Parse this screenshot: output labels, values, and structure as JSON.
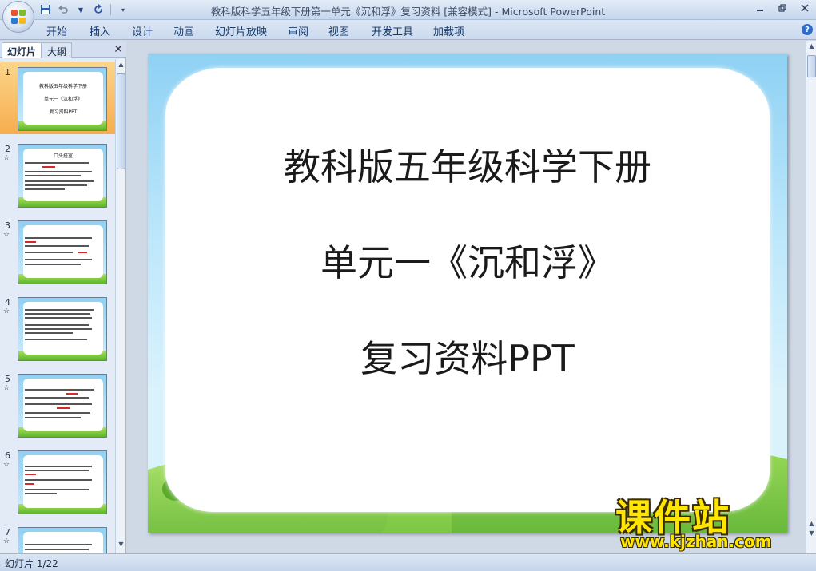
{
  "window": {
    "title": "教科版科学五年级下册第一单元《沉和浮》复习资料 [兼容模式] - Microsoft PowerPoint"
  },
  "ribbon": {
    "tabs": [
      "开始",
      "插入",
      "设计",
      "动画",
      "幻灯片放映",
      "审阅",
      "视图",
      "开发工具",
      "加载项"
    ]
  },
  "left_pane": {
    "tabs": [
      "幻灯片",
      "大纲"
    ],
    "active_tab": "幻灯片",
    "thumbnails": [
      {
        "number": "1",
        "lines": [
          "教科版五年级科学下册",
          "单元一《沉和浮》",
          "复习资料PPT"
        ],
        "selected": true,
        "animated": false
      },
      {
        "number": "2",
        "lines": [
          "口头搭室"
        ],
        "selected": false,
        "animated": true
      },
      {
        "number": "3",
        "lines": [],
        "selected": false,
        "animated": true
      },
      {
        "number": "4",
        "lines": [],
        "selected": false,
        "animated": true
      },
      {
        "number": "5",
        "lines": [],
        "selected": false,
        "animated": true
      },
      {
        "number": "6",
        "lines": [],
        "selected": false,
        "animated": true
      },
      {
        "number": "7",
        "lines": [],
        "selected": false,
        "animated": true
      }
    ]
  },
  "slide": {
    "line1": "教科版五年级科学下册",
    "line2": "单元一《沉和浮》",
    "line3": "复习资料PPT"
  },
  "watermark": {
    "text_cn": "课件站",
    "url": "www.kjzhan.com"
  },
  "status": {
    "slide_indicator": "幻灯片 1/22"
  },
  "colors": {
    "selected_thumb": "#f6ad4f",
    "watermark": "#ffe600"
  }
}
